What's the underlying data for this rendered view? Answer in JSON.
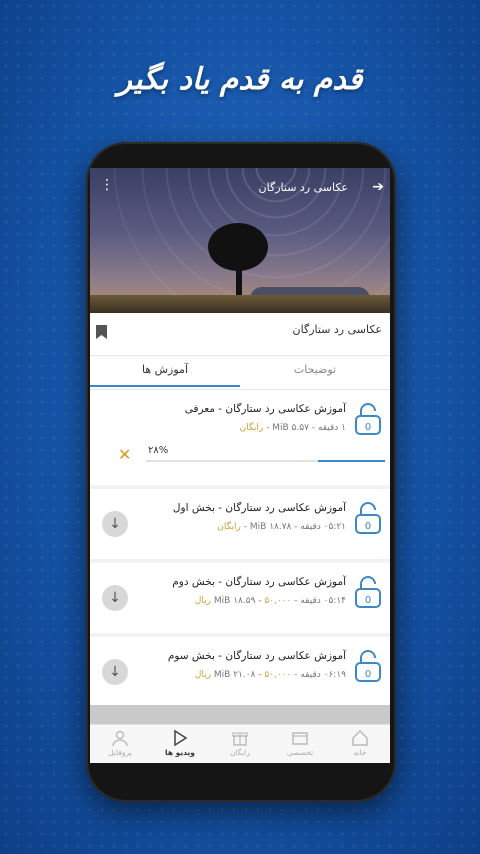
{
  "promo": {
    "headline": "قدم به قدم یاد بگیر"
  },
  "header": {
    "title": "عکاسی رد ستارگان"
  },
  "course": {
    "title": "عکاسی رد ستارگان"
  },
  "tabs": [
    {
      "label": "توضیحات",
      "active": false
    },
    {
      "label": "آموزش ها",
      "active": true
    }
  ],
  "lessons": [
    {
      "title": "آموزش عکاسی رد ستارگان - معرفی",
      "meta": "۱ دقیقه - MiB ۵.۵۷ - ",
      "price": "رایگان",
      "lock_number": "0",
      "downloading": true,
      "progress_label": "۲۸%",
      "progress": 0.28
    },
    {
      "title": "آموزش عکاسی رد ستارگان - بخش اول",
      "meta": "۰۵:۲۱ دقیقه - MiB ۱۸.۷۸ - ",
      "price": "رایگان",
      "lock_number": "0"
    },
    {
      "title": "آموزش عکاسی رد ستارگان - بخش دوم",
      "meta": "۰۵:۱۴ دقیقه - MiB ۱۸.۵۹ - ",
      "price": "۵۰,۰۰۰ ریال",
      "lock_number": "0"
    },
    {
      "title": "آموزش عکاسی رد ستارگان - بخش سوم",
      "meta": "۰۶:۱۹ دقیقه - MiB ۲۱.۰۸ - ",
      "price": "۵۰,۰۰۰ ریال",
      "lock_number": "0"
    }
  ],
  "bottom_nav": [
    {
      "label": "خانه",
      "icon": "home-icon",
      "active": false
    },
    {
      "label": "تخصصی",
      "icon": "folder-icon",
      "active": false
    },
    {
      "label": "رایگان",
      "icon": "gift-icon",
      "active": false
    },
    {
      "label": "ویدیو ها",
      "icon": "play-icon",
      "active": true
    },
    {
      "label": "پروفایل",
      "icon": "user-icon",
      "active": false
    }
  ],
  "colors": {
    "accent": "#3d88c7",
    "price": "#c9a23a",
    "background": "#1553a6"
  }
}
